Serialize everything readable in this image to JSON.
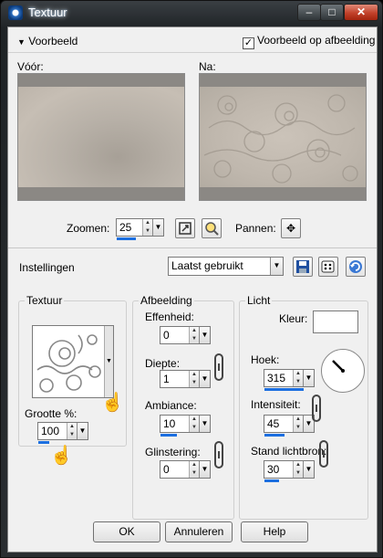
{
  "window": {
    "title": "Textuur",
    "min_glyph": "–",
    "max_glyph": "□",
    "close_glyph": "✕"
  },
  "preview": {
    "toggle_label": "Voorbeeld",
    "on_image_label": "Voorbeeld op afbeelding",
    "on_image_checked": true,
    "before_label": "Vóór:",
    "after_label": "Na:",
    "zoom_label": "Zoomen:",
    "zoom_value": "25",
    "pan_label": "Pannen:"
  },
  "settings": {
    "label": "Instellingen",
    "preset_value": "Laatst gebruikt"
  },
  "texture": {
    "group_label": "Textuur",
    "size_label": "Grootte %:",
    "size_value": "100"
  },
  "image": {
    "group_label": "Afbeelding",
    "smoothness_label": "Effenheid:",
    "smoothness_value": "0",
    "depth_label": "Diepte:",
    "depth_value": "1",
    "ambiance_label": "Ambiance:",
    "ambiance_value": "10",
    "shine_label": "Glinstering:",
    "shine_value": "0"
  },
  "light": {
    "group_label": "Licht",
    "color_label": "Kleur:",
    "angle_label": "Hoek:",
    "angle_value": "315",
    "intensity_label": "Intensiteit:",
    "intensity_value": "45",
    "elevation_label": "Stand lichtbron:",
    "elevation_value": "30"
  },
  "buttons": {
    "ok": "OK",
    "cancel": "Annuleren",
    "help": "Help"
  },
  "colors": {
    "accent": "#1c6fe0",
    "light_color": "#ffffff"
  }
}
